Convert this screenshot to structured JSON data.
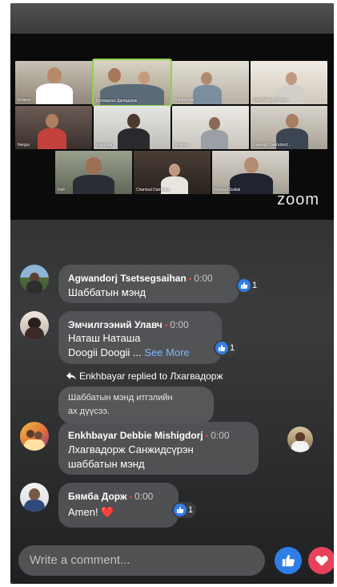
{
  "video": {
    "logo": "zoom",
    "participants": [
      {
        "name": "Erdene"
      },
      {
        "name": "Батжаргал Дагвадорж"
      },
      {
        "name": "Baatarmaa"
      },
      {
        "name": "Ganchimeg Tsogze..."
      },
      {
        "name": "Nergui"
      },
      {
        "name": "Gantulga"
      },
      {
        "name": "Amaraa"
      },
      {
        "name": "Gantugs Dashdond..."
      },
      {
        "name": "Dell"
      },
      {
        "name": "Chantsal Dambasu"
      },
      {
        "name": "Richard Sallak"
      }
    ]
  },
  "comments": [
    {
      "author": "Agwandorj Tsetsegsaihan",
      "time": "0:00",
      "text": "Шаббатын мэнд",
      "likes": "1"
    },
    {
      "author": "Эмчилгээний Улавч",
      "time": "0:00",
      "text_line1": "Наташ Наташа",
      "text_line2": "Doogii Doogii ...",
      "see_more": "See More",
      "likes": "1"
    },
    {
      "reply_note": "Enkhbayar replied to Лхагвадорж",
      "quote_line1": "Шаббатын мэнд итгэлийн",
      "quote_line2": "ах дүүсээ.",
      "author": "Enkhbayar Debbie Mishigdorj",
      "time": "0:00",
      "text_line1": "Лхагвадорж Санжидсүрэн",
      "text_line2": "шаббатын мэнд"
    },
    {
      "author": "Бямба Дорж",
      "time": "0:00",
      "text": "Amen!",
      "emoji": "❤️",
      "likes": "1"
    }
  ],
  "composer": {
    "placeholder": "Write a comment..."
  },
  "colors": {
    "like": "#2f7ee8",
    "love": "#e8425a",
    "accent_dot": "#e9483f"
  }
}
